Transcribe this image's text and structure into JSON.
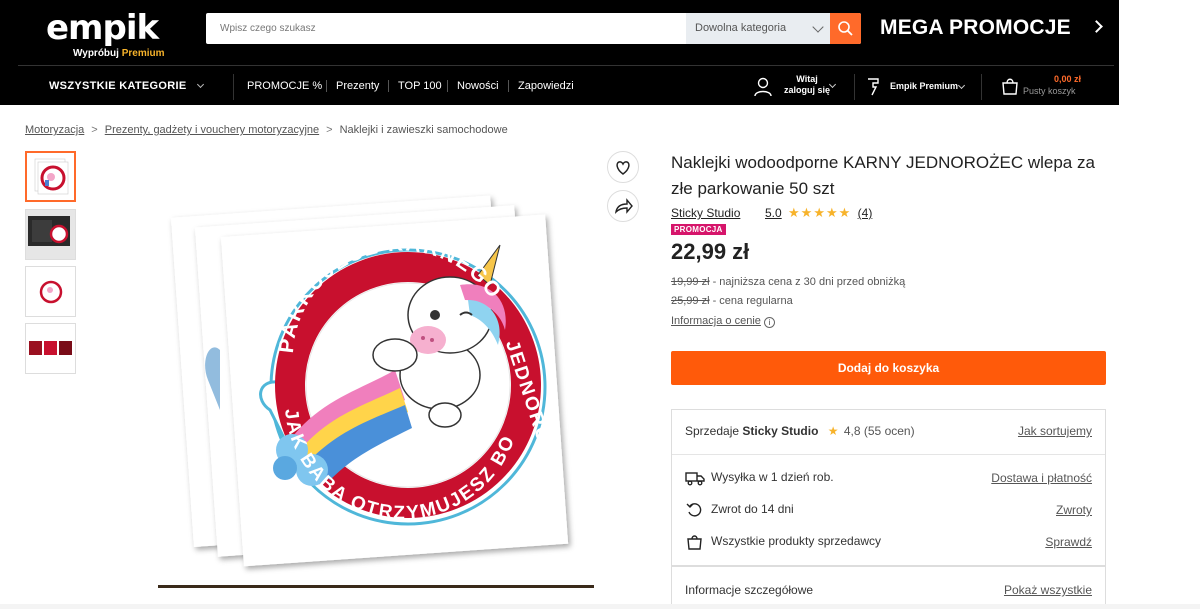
{
  "header": {
    "logo": "empik",
    "logo_sub_prefix": "Wypróbuj",
    "logo_sub_premium": "Premium",
    "search_placeholder": "Wpisz czego szukasz",
    "search_category": "Dowolna kategoria",
    "mega_promo": "MEGA PROMOCJE"
  },
  "nav": {
    "all_categories": "WSZYSTKIE KATEGORIE",
    "links": [
      "PROMOCJE %",
      "Prezenty",
      "TOP 100",
      "Nowości",
      "Zapowiedzi"
    ],
    "user_line1": "Witaj",
    "user_line2": "zaloguj się",
    "premium": "Empik Premium",
    "cart_price": "0,00 zł",
    "cart_empty": "Pusty koszyk"
  },
  "breadcrumb": {
    "items": [
      "Motoryzacja",
      "Prezenty, gadżety i vouchery motoryzacyjne"
    ],
    "current": "Naklejki i zawieszki samochodowe",
    "separator": ">"
  },
  "product": {
    "title": "Naklejki wodoodporne KARNY JEDNOROŻEC wlepa za złe parkowanie 50 szt",
    "seller": "Sticky Studio",
    "rating": "5.0",
    "stars": "★★★★★",
    "review_count": "(4)",
    "badge": "PROMOCJA",
    "price": "22,99 zł",
    "lowest_price": "19,99 zł",
    "lowest_price_note": " - najniższa cena z 30 dni przed obniżką",
    "regular_price": "25,99 zł",
    "regular_price_note": " - cena regularna",
    "price_info_link": "Informacja o cenie",
    "add_to_cart": "Dodaj do koszyka"
  },
  "sticker": {
    "top_text": "PARKUJESZ KARNEGO",
    "right_text": "JEDNOROŻCA",
    "bottom_text": "JAK BABA OTRZYMUJESZ BO"
  },
  "seller_box": {
    "sold_by_label": "Sprzedaje",
    "seller": "Sticky Studio",
    "star": "★",
    "score": "4,8",
    "score_count": "(55 ocen)",
    "sort_link": "Jak sortujemy",
    "shipping": "Wysyłka w 1 dzień rob.",
    "shipping_link": "Dostawa i płatność",
    "return": "Zwrot do 14 dni",
    "return_link": "Zwroty",
    "all_products": "Wszystkie produkty sprzedawcy",
    "all_products_link": "Sprawdź"
  },
  "details": {
    "label": "Informacje szczegółowe",
    "link": "Pokaż wszystkie"
  },
  "colors": {
    "accent": "#ff5a0a",
    "promo": "#d6156b",
    "star": "#f7b32b",
    "sticker_red": "#c8102e"
  }
}
